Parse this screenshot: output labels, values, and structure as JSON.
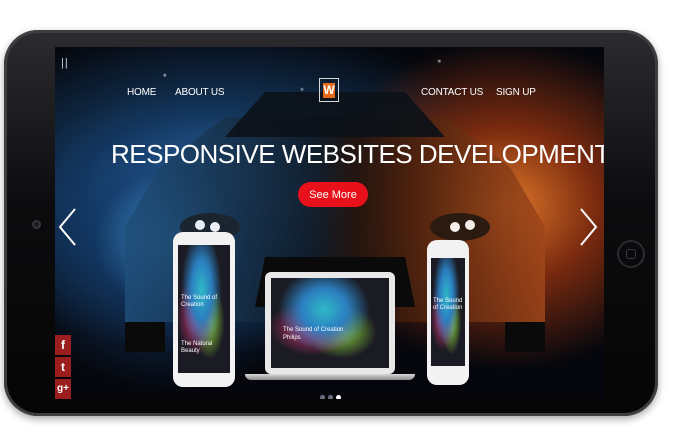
{
  "nav": {
    "menu_icon": "||",
    "home": "HOME",
    "about": "ABOUT US",
    "logo_letter": "W",
    "contact": "CONTACT US",
    "signup": "SIGN UP"
  },
  "hero": {
    "headline": "RESPONSIVE WEBSITES DEVELOPMENT",
    "cta_label": "See More"
  },
  "devices": {
    "tablet_caption_1": "The Sound of Creation",
    "tablet_caption_2": "The Natural Beauty",
    "laptop_caption_1": "The Sound of Creation",
    "laptop_caption_2": "Philips",
    "phone_caption": "The Sound of Creation"
  },
  "social": {
    "facebook": "f",
    "twitter": "t",
    "google_plus": "g+"
  },
  "carousel": {
    "dots": 3,
    "active_dot": 3
  },
  "colors": {
    "cta": "#e8101a",
    "social_bg": "#9b1e1e",
    "logo_accent": "#e56b1a"
  },
  "icons": [
    "menu-icon",
    "logo-icon",
    "chevron-left-icon",
    "chevron-right-icon",
    "facebook-icon",
    "twitter-icon",
    "google-plus-icon"
  ]
}
